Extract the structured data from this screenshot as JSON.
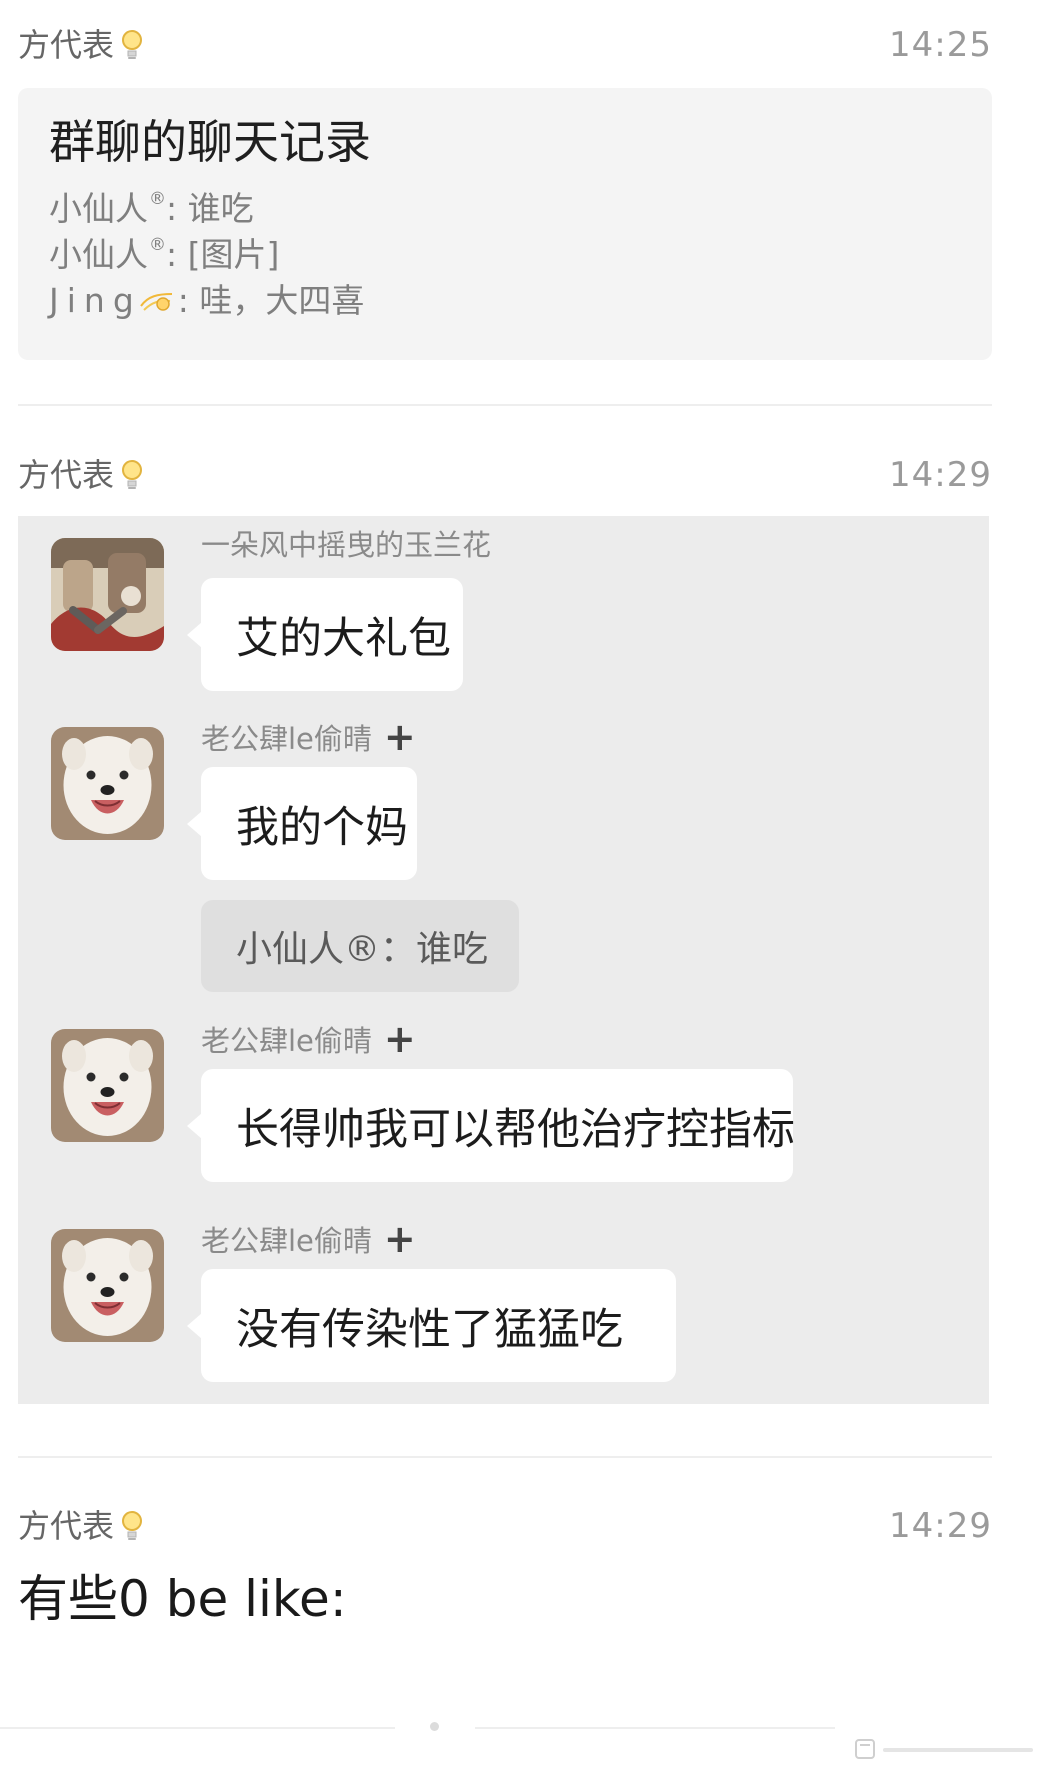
{
  "messages": [
    {
      "sender": "方代表",
      "time": "14:25",
      "record": {
        "title": "群聊的聊天记录",
        "lines": [
          {
            "name": "小仙人",
            "mark": "®",
            "text": ": 谁吃"
          },
          {
            "name": "小仙人",
            "mark": "®",
            "text": ": [图片]"
          },
          {
            "name": "Jing",
            "emoji": "comet-icon",
            "text": ": 哇，大四喜"
          }
        ]
      }
    },
    {
      "sender": "方代表",
      "time": "14:29",
      "chat": [
        {
          "name": "一朵风中摇曳的玉兰花",
          "avatar": "collage-avatar",
          "text": "艾的大礼包"
        },
        {
          "name": "老公肆le偷晴",
          "avatar": "samoyed-avatar",
          "badge": "+",
          "text": "我的个妈",
          "quote": "小仙人®：谁吃"
        },
        {
          "name": "老公肆le偷晴",
          "avatar": "samoyed-avatar",
          "badge": "+",
          "text": "长得帅我可以帮他治疗控指标"
        },
        {
          "name": "老公肆le偷晴",
          "avatar": "samoyed-avatar",
          "badge": "+",
          "text": "没有传染性了猛猛吃"
        }
      ]
    },
    {
      "sender": "方代表",
      "time": "14:29",
      "text": "有些0 be like:"
    }
  ],
  "colors": {
    "background": "#ffffff",
    "card": "#f4f4f4",
    "chat_block": "#ececec",
    "bubble": "#ffffff",
    "quote": "#dfdfdf"
  }
}
